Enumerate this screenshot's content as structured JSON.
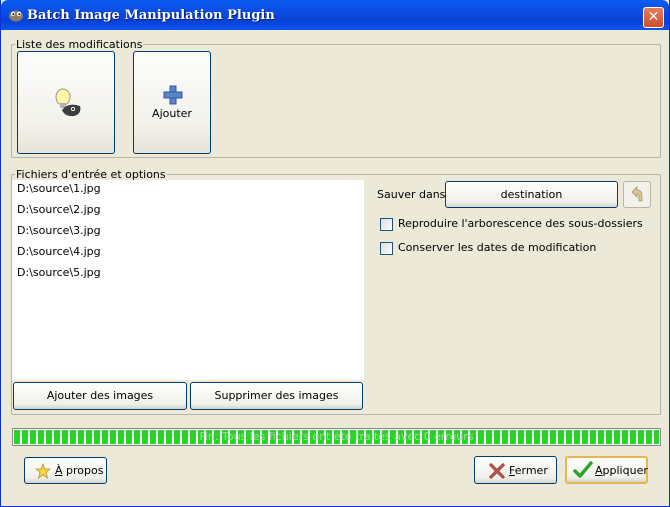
{
  "window": {
    "title": "Batch Image Manipulation Plugin",
    "close_glyph": "✕"
  },
  "modifications": {
    "label": "Liste des modifications",
    "add_button_label": "Ajouter"
  },
  "files": {
    "label": "Fichiers d'entrée et options",
    "items": [
      "D:\\source\\1.jpg",
      "D:\\source\\2.jpg",
      "D:\\source\\3.jpg",
      "D:\\source\\4.jpg",
      "D:\\source\\5.jpg"
    ],
    "add_images_label": "Ajouter des images",
    "remove_images_label": "Supprimer des images"
  },
  "options": {
    "save_in_label": "Sauver dans",
    "destination_label": "destination",
    "reproduce_tree_label": "Reproduire l'arborescence des sous-dossiers",
    "reproduce_tree_checked": false,
    "keep_dates_label": "Conserver les dates de modification",
    "keep_dates_checked": false
  },
  "progress": {
    "text": "Fin. Tous les fichiers ont été traités avec 0 erreurs",
    "fraction": 1.0
  },
  "footer": {
    "about_label": "À propos",
    "close_label": "Fermer",
    "apply_label": "Appliquer"
  },
  "icons": {
    "title": "gimp-icon",
    "modification": "gimp-bulb-icon",
    "add": "plus-icon",
    "arrow": "arrow-icon",
    "about": "star-icon",
    "close": "red-x-icon",
    "apply": "green-check-icon"
  },
  "colors": {
    "titlebar": "#0a55ee",
    "progress": "#2ad32a",
    "window_bg": "#ece9d8"
  }
}
